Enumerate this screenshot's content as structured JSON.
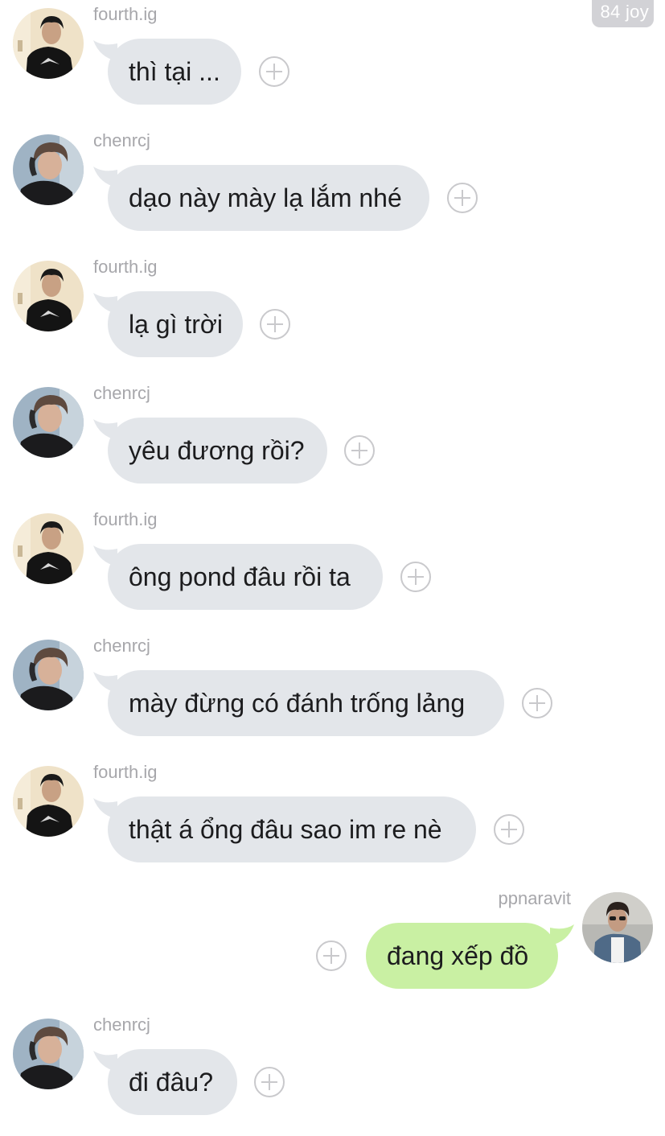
{
  "badge": {
    "label": "84 joy"
  },
  "colors": {
    "incoming_bubble": "#e3e6ea",
    "outgoing_bubble": "#c9f0a3",
    "sender_text": "#a7a7ab",
    "badge_background": "#d2d2d6"
  },
  "messages": [
    {
      "side": "left",
      "sender": "fourth.ig",
      "text": "thì tại ...",
      "avatar": "avatar-fourth"
    },
    {
      "side": "left",
      "sender": "chenrcj",
      "text": "dạo này mày lạ lắm nhé",
      "avatar": "avatar-chen"
    },
    {
      "side": "left",
      "sender": "fourth.ig",
      "text": "lạ gì trời",
      "avatar": "avatar-fourth"
    },
    {
      "side": "left",
      "sender": "chenrcj",
      "text": "yêu đương rồi?",
      "avatar": "avatar-chen"
    },
    {
      "side": "left",
      "sender": "fourth.ig",
      "text": "ông pond đâu rồi ta",
      "avatar": "avatar-fourth"
    },
    {
      "side": "left",
      "sender": "chenrcj",
      "text": "mày đừng có đánh trống lảng",
      "avatar": "avatar-chen"
    },
    {
      "side": "left",
      "sender": "fourth.ig",
      "text": "thật á ổng đâu sao im re nè",
      "avatar": "avatar-fourth"
    },
    {
      "side": "right",
      "sender": "ppnaravit",
      "text": "đang xếp đồ",
      "avatar": "avatar-pp"
    },
    {
      "side": "left",
      "sender": "chenrcj",
      "text": "đi đâu?",
      "avatar": "avatar-chen"
    }
  ]
}
